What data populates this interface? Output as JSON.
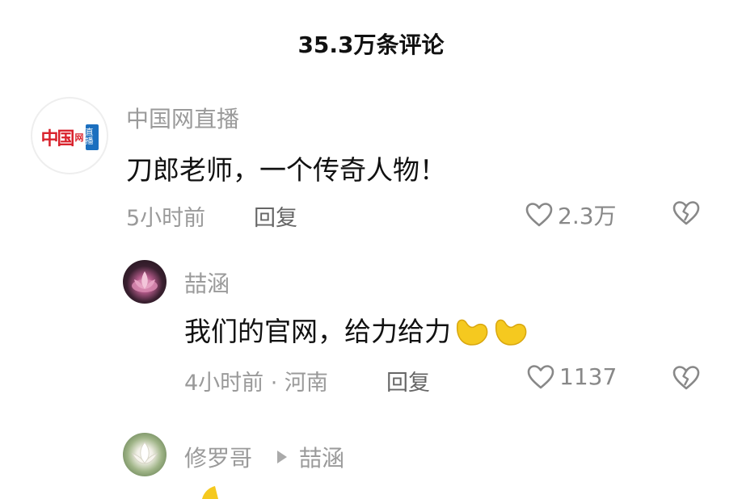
{
  "header": {
    "title": "35.3万条评论"
  },
  "comment1": {
    "avatar_icon": "china-net-live-logo",
    "logo_text": "中国",
    "logo_small": "网",
    "logo_box": "直播",
    "username": "中国网直播",
    "text": "刀郎老师，一个传奇人物！",
    "time": "5小时前",
    "reply_label": "回复",
    "like_count": "2.3万"
  },
  "reply1": {
    "username": "喆涵",
    "text": "我们的官网，给力给力",
    "time": "4小时前 · 河南",
    "reply_label": "回复",
    "like_count": "1137",
    "emoji": "flexed-biceps"
  },
  "reply2": {
    "username": "修罗哥",
    "reply_to": "喆涵"
  },
  "colors": {
    "logo_red": "#d9232d",
    "logo_blue": "#1b6fbf",
    "muted_text": "#9a9a9a",
    "emoji_yellow": "#f5c91f"
  }
}
